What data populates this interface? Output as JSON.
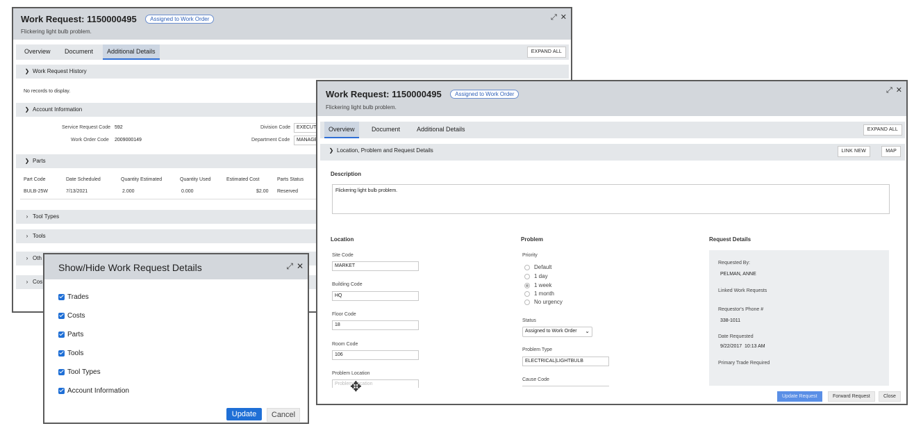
{
  "back_window": {
    "title": "Work Request: 1150000495",
    "badge": "Assigned to Work Order",
    "subtitle": "Flickering light bulb problem.",
    "tabs": [
      "Overview",
      "Document",
      "Additional Details"
    ],
    "expand_all": "EXPAND ALL",
    "sections": {
      "history": "Work Request History",
      "history_empty": "No records to display.",
      "account": "Account Information",
      "parts": "Parts",
      "tool_types": "Tool Types",
      "tools": "Tools",
      "other": "Oth",
      "costs": "Cos"
    },
    "account": {
      "service_request_label": "Service Request Code",
      "service_request_value": "592",
      "work_order_label": "Work Order Code",
      "work_order_value": "2009000149",
      "division_label": "Division Code",
      "division_value": "EXECUTIV",
      "department_label": "Department Code",
      "department_value": "MANAGE"
    },
    "parts_table": {
      "headers": [
        "Part Code",
        "Date Scheduled",
        "Quantity Estimated",
        "Quantity Used",
        "Estimated Cost",
        "Parts Status"
      ],
      "rows": [
        [
          "BULB-25W",
          "7/13/2021",
          "2.000",
          "0.000",
          "$2.00",
          "Reserved"
        ]
      ]
    }
  },
  "front_window": {
    "title": "Work Request: 1150000495",
    "badge": "Assigned to Work Order",
    "subtitle": "Flickering light bulb problem.",
    "tabs": [
      "Overview",
      "Document",
      "Additional Details"
    ],
    "expand_all": "EXPAND ALL",
    "section_title": "Location, Problem and Request Details",
    "link_new": "LINK NEW",
    "map": "MAP",
    "description_label": "Description",
    "description_value": "Flickering light bulb problem.",
    "location": {
      "heading": "Location",
      "site_code_label": "Site Code",
      "site_code": "MARKET",
      "building_code_label": "Building Code",
      "building_code": "HQ",
      "floor_code_label": "Floor Code",
      "floor_code": "18",
      "room_code_label": "Room Code",
      "room_code": "106",
      "problem_location_label": "Problem Location",
      "problem_location_placeholder": "Problem Location"
    },
    "problem": {
      "heading": "Problem",
      "priority_label": "Priority",
      "priorities": [
        "Default",
        "1 day",
        "1 week",
        "1 month",
        "No urgency"
      ],
      "selected_priority": "1 week",
      "status_label": "Status",
      "status_value": "Assigned to Work Order",
      "problem_type_label": "Problem Type",
      "problem_type_value": "ELECTRICAL|LIGHTBULB",
      "cause_code_label": "Cause Code"
    },
    "request_details": {
      "heading": "Request Details",
      "requested_by_label": "Requested By:",
      "requested_by": "PELMAN, ANNE",
      "linked_label": "Linked Work Requests",
      "phone_label": "Requestor's Phone #",
      "phone": "338-1011",
      "date_label": "Date Requested",
      "date": "9/22/2017  10:13 AM",
      "trade_label": "Primary Trade Required"
    },
    "buttons": {
      "update": "Update Request",
      "forward": "Forward Request",
      "close": "Close"
    }
  },
  "dialog": {
    "title": "Show/Hide Work Request Details",
    "options": [
      "Trades",
      "Costs",
      "Parts",
      "Tools",
      "Tool Types",
      "Account Information"
    ],
    "update": "Update",
    "cancel": "Cancel"
  },
  "colors": {
    "accent": "#2f6fd6",
    "header_bg": "#d3d7dc",
    "bar_bg": "#e4e7ea"
  }
}
